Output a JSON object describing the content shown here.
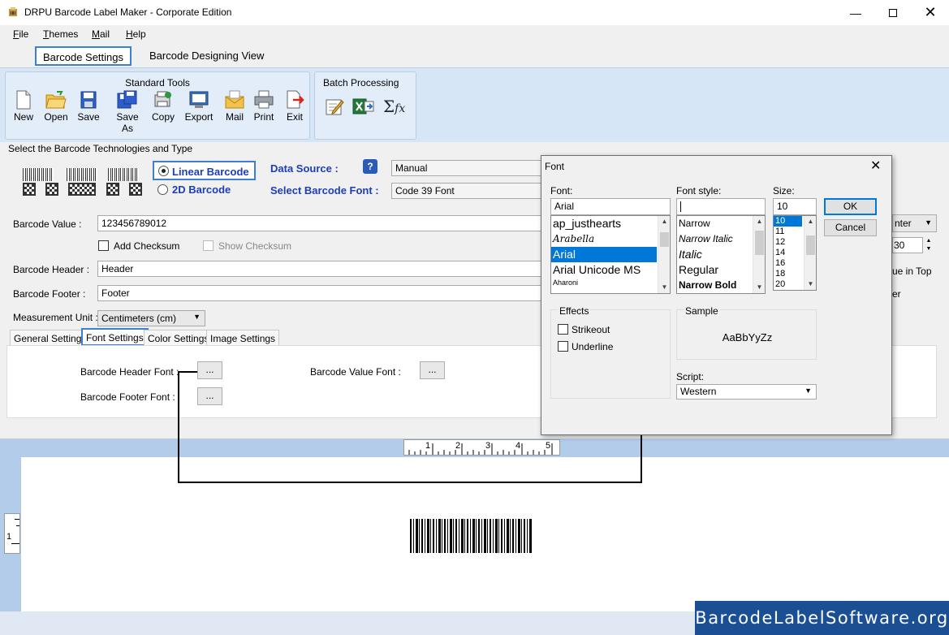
{
  "window": {
    "title": "DRPU Barcode Label Maker - Corporate Edition"
  },
  "menu": [
    {
      "label": "File",
      "u": "F",
      "rest": "ile"
    },
    {
      "label": "Themes",
      "u": "T",
      "rest": "hemes"
    },
    {
      "label": "Mail",
      "u": "M",
      "rest": "ail"
    },
    {
      "label": "Help",
      "u": "H",
      "rest": "elp"
    }
  ],
  "tabs": {
    "settings": "Barcode Settings",
    "designing": "Barcode Designing View"
  },
  "ribbon": {
    "standard_title": "Standard Tools",
    "batch_title": "Batch Processing",
    "tools": [
      "New",
      "Open",
      "Save",
      "Save As",
      "Copy",
      "Export",
      "Mail",
      "Print",
      "Exit"
    ]
  },
  "panel": {
    "tech_label": "Select the Barcode Technologies and Type",
    "linear": "Linear Barcode",
    "twod": "2D Barcode",
    "data_source_label": "Data Source :",
    "data_source_value": "Manual",
    "font_label": "Select Barcode Font :",
    "font_value": "Code 39 Font",
    "barcode_value_label": "Barcode Value :",
    "barcode_value": "123456789012",
    "add_checksum": "Add Checksum",
    "show_checksum": "Show Checksum",
    "header_label": "Barcode Header :",
    "header_value": "Header",
    "footer_label": "Barcode Footer :",
    "footer_value": "Footer",
    "unit_label": "Measurement Unit :",
    "unit_value": "Centimeters (cm)",
    "right_partial": {
      "align": "nter",
      "spin": "30",
      "top": "ue in Top",
      "er": "er"
    },
    "subtabs": [
      "General Settings",
      "Font Settings",
      "Color Settings",
      "Image Settings"
    ],
    "header_font_label": "Barcode Header Font :",
    "footer_font_label": "Barcode Footer Font :",
    "value_font_label": "Barcode Value Font :",
    "dots": "..."
  },
  "ruler": {
    "h": [
      "1",
      "2",
      "3",
      "4",
      "5"
    ],
    "v": "1"
  },
  "font_dialog": {
    "title": "Font",
    "font_label": "Font:",
    "font_value": "Arial",
    "fonts": [
      "ap_justhearts",
      "Arabella",
      "Arial",
      "Arial Unicode MS",
      "Aharoni"
    ],
    "style_label": "Font style:",
    "style_value": "",
    "styles": [
      "Narrow",
      "Narrow Italic",
      "Italic",
      "Regular",
      "Narrow Bold"
    ],
    "size_label": "Size:",
    "size_value": "10",
    "sizes": [
      "10",
      "11",
      "12",
      "14",
      "16",
      "18",
      "20"
    ],
    "ok": "OK",
    "cancel": "Cancel",
    "effects_label": "Effects",
    "strikeout": "Strikeout",
    "underline": "Underline",
    "sample_label": "Sample",
    "sample_text": "AaBbYyZz",
    "script_label": "Script:",
    "script_value": "Western"
  },
  "watermark": "BarcodeLabelSoftware.org"
}
